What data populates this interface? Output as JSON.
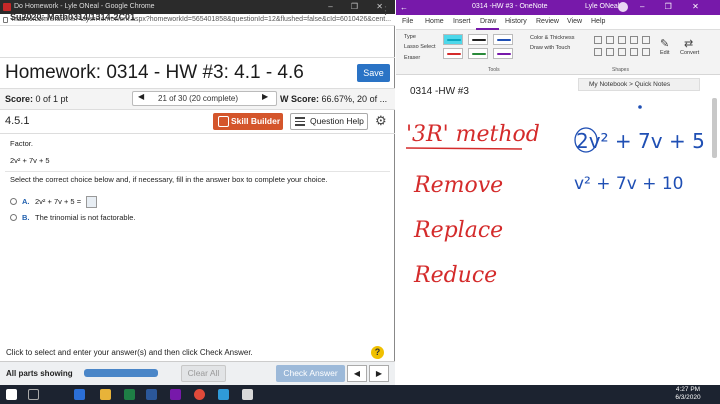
{
  "chrome": {
    "window_title": "Do Homework - Lyle ONeal - Google Chrome",
    "window_controls": "–  ❐  ✕",
    "url_host": "mathxl.com",
    "url_path": "/Student/PlayerHomework.aspx?homeworkId=565401858&questionId=12&flushed=false&cId=6010426&cent...",
    "course": "Su2020: Math0314/1314-2C01",
    "hw_title": "Homework: 0314 - HW #3: 4.1 - 4.6",
    "save_label": "Save",
    "score_label": "Score:",
    "score_value": "0 of 1 pt",
    "nav_prev": "◀",
    "nav_text": "21 of 30 (20 complete)",
    "nav_next": "▶",
    "hw_score_label": "W Score:",
    "hw_score_value": "66.67%, 20 of ...",
    "question_number": "4.5.1",
    "skill_builder": "Skill Builder",
    "question_help": "Question Help",
    "gear": "⚙",
    "instruction": "Factor.",
    "expression": "2v² + 7v + 5",
    "select_instruction": "Select the correct choice below and, if necessary, fill in the answer box to complete your choice.",
    "option_a_letter": "A.",
    "option_a_text": "2v² + 7v + 5 =",
    "option_b_letter": "B.",
    "option_b_text": "The trinomial is not factorable.",
    "footer_hint": "Click to select and enter your answer(s) and then click Check Answer.",
    "hint_help": "?",
    "parts_label": "All parts showing",
    "clear_all": "Clear All",
    "check_answer": "Check Answer",
    "prev": "◀",
    "next": "▶"
  },
  "onenote": {
    "back": "←",
    "title": "0314 -HW #3  -  OneNote",
    "user": "Lyle ONeal",
    "window_controls": "–  ❐  ✕",
    "tabs": [
      "File",
      "Home",
      "Insert",
      "Draw",
      "History",
      "Review",
      "View",
      "Help"
    ],
    "ribbon": {
      "type": "Type",
      "lasso": "Lasso Select",
      "eraser": "Eraser",
      "color_thickness": "Color & Thickness",
      "draw_with_touch": "Draw with Touch",
      "tools_label": "Tools",
      "shapes_label": "Shapes",
      "edit": "Edit",
      "convert": "Convert"
    },
    "notebook_crumb": "My Notebook > Quick Notes",
    "page_title": "0314 -HW #3",
    "ink": {
      "method": "'3R' method",
      "remove": "Remove",
      "replace": "Replace",
      "reduce": "Reduce",
      "expr1": "2v² + 7v + 5",
      "expr2": "v² + 7v + 10"
    },
    "colors": {
      "accent": "#7719aa",
      "red_ink": "#d42b2b",
      "blue_ink": "#1f4fb4"
    }
  },
  "taskbar": {
    "time": "4:27 PM",
    "date": "6/3/2020"
  }
}
